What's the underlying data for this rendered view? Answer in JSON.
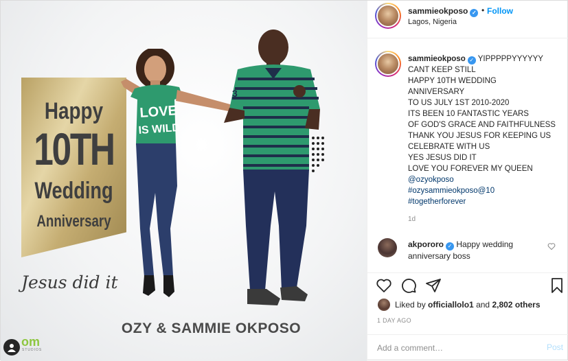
{
  "image": {
    "banner": {
      "line1": "Happy",
      "line2": "10TH",
      "line3": "Wedding",
      "line4": "Anniversary"
    },
    "tagline": "Jesus did it",
    "couple_name": "OZY & SAMMIE OKPOSO",
    "studio_logo": "om",
    "studio_sub": "STUDIOS",
    "shirt_text_1": "LOVE",
    "shirt_text_2": "IS WILD",
    "jersey_number": "3",
    "colors": {
      "banner_gold": "#c9b276",
      "shirt_green": "#2e9a6e",
      "stripe_navy": "#1e2e4a",
      "jeans": "#2c3e6b",
      "logo_green": "#8dc63f"
    }
  },
  "header": {
    "username": "sammieokposo",
    "verified_icon": "verified-badge-icon",
    "separator": "•",
    "follow_label": "Follow",
    "location": "Lagos, Nigeria"
  },
  "caption": {
    "username": "sammieokposo",
    "lines": [
      "YIPPPPPYYYYYY",
      "CANT KEEP STILL",
      "HAPPY 10TH WEDDING",
      "ANNIVERSARY",
      "TO US JULY 1ST 2010-2020",
      "ITS BEEN 10 FANTASTIC YEARS",
      "OF GOD'S GRACE AND FAITHFULNESS",
      "THANK YOU JESUS FOR KEEPING US",
      "CELEBRATE WITH US",
      "YES JESUS DID IT",
      "LOVE YOU FOREVER MY QUEEN"
    ],
    "mention": "@ozyokposo",
    "hashtag1": "#ozysammieokposo@10",
    "hashtag2": "#togetherforever",
    "age": "1d"
  },
  "comment": {
    "username": "akpororo",
    "text": "Happy wedding anniversary boss"
  },
  "actions": {
    "icons": [
      "heart-icon",
      "comment-icon",
      "share-icon",
      "bookmark-icon"
    ],
    "liked_by_prefix": "Liked by",
    "liked_by_user": "officiallolo1",
    "liked_by_and": "and",
    "others": "2,802 others",
    "date": "1 DAY AGO"
  },
  "add_comment": {
    "placeholder": "Add a comment…",
    "post_label": "Post"
  }
}
